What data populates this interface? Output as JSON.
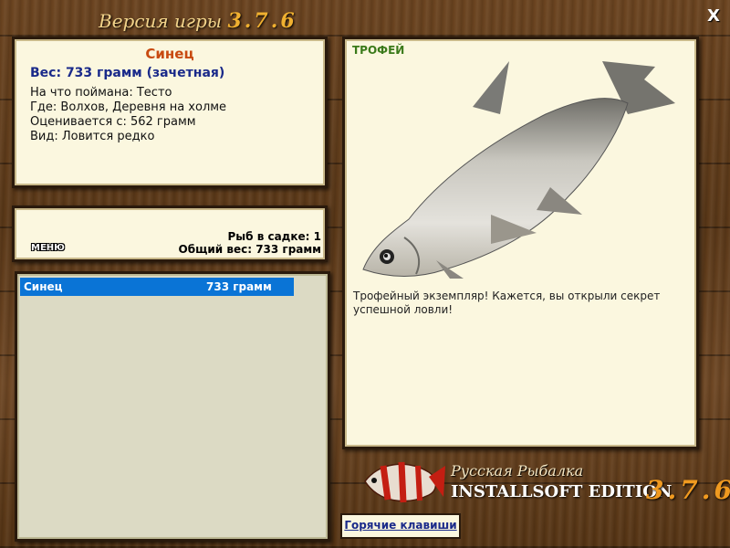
{
  "window": {
    "title": "Версия игры",
    "version": "3.7.6",
    "close_label": "X"
  },
  "catch": {
    "name": "Синец",
    "weight": "Вес: 733 грамм (зачетная)",
    "bait": "На что поймана: Тесто",
    "location": "Где: Волхов, Деревня на холме",
    "rated_from": "Оценивается с: 562 грамм",
    "rarity": "Вид: Ловится редко"
  },
  "keepnet": {
    "menu_label": "МЕНЮ",
    "fish_count": "Рыб в садке: 1",
    "total_weight": "Общий вес: 733 грамм"
  },
  "fish_list": [
    {
      "name": "Синец",
      "weight": "733 грамм"
    }
  ],
  "fish_view": {
    "trophy_label": "ТРОФЕЙ",
    "description": "Трофейный экземпляр! Кажется, вы открыли секрет успешной ловли!",
    "icon": "bream-fish-illustration"
  },
  "brand": {
    "line1": "Русская Рыбалка",
    "line2": "INSTALLSOFT EDITION",
    "version": "3.7.6",
    "icon": "red-striped-fish-logo"
  },
  "hotkeys_label": "Горячие клавиши"
}
